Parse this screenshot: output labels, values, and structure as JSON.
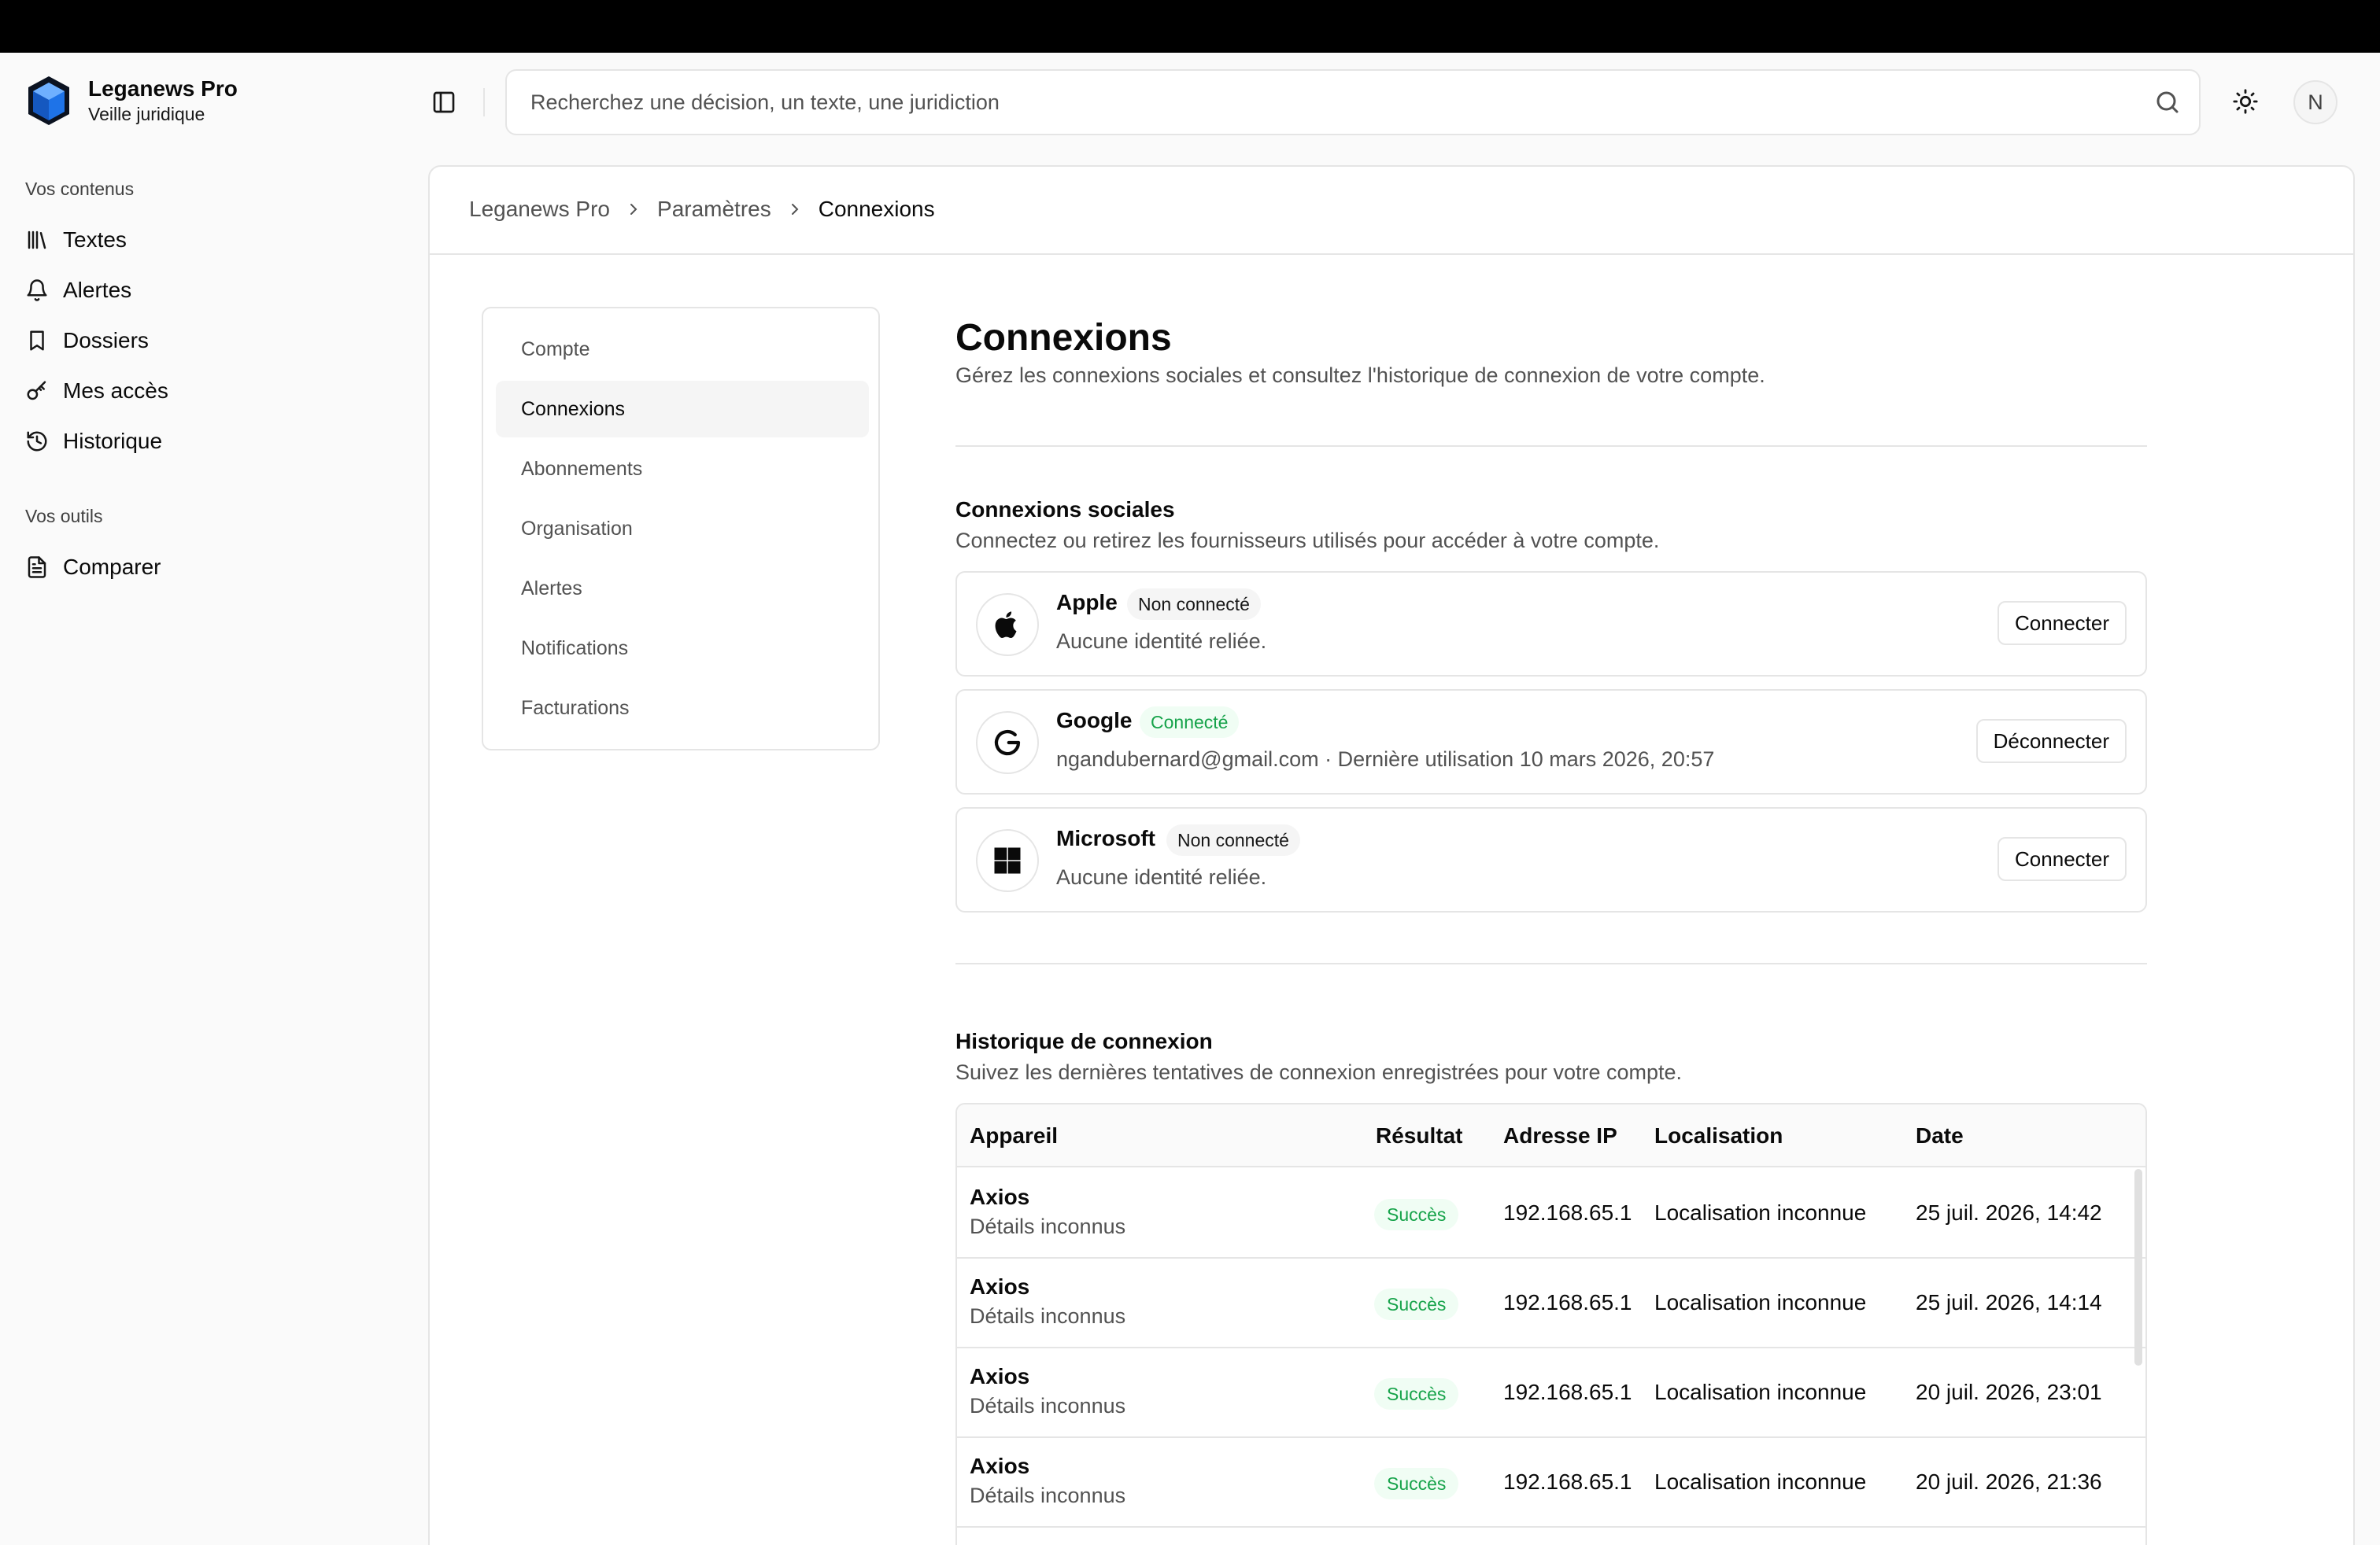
{
  "brand": {
    "name": "Leganews Pro",
    "subtitle": "Veille juridique"
  },
  "sidebar": {
    "group1_label": "Vos contenus",
    "items": [
      {
        "label": "Textes",
        "icon": "library-icon"
      },
      {
        "label": "Alertes",
        "icon": "bell-icon"
      },
      {
        "label": "Dossiers",
        "icon": "bookmark-icon"
      },
      {
        "label": "Mes accès",
        "icon": "key-icon"
      },
      {
        "label": "Historique",
        "icon": "history-icon"
      }
    ],
    "group2_label": "Vos outils",
    "tools": [
      {
        "label": "Comparer",
        "icon": "document-icon"
      }
    ]
  },
  "search": {
    "placeholder": "Recherchez une décision, un texte, une juridiction"
  },
  "user": {
    "initial": "N"
  },
  "breadcrumb": [
    "Leganews Pro",
    "Paramètres",
    "Connexions"
  ],
  "settings_nav": [
    "Compte",
    "Connexions",
    "Abonnements",
    "Organisation",
    "Alertes",
    "Notifications",
    "Facturations"
  ],
  "page": {
    "title": "Connexions",
    "subtitle": "Gérez les connexions sociales et consultez l'historique de connexion de votre compte."
  },
  "social": {
    "title": "Connexions sociales",
    "subtitle": "Connectez ou retirez les fournisseurs utilisés pour accéder à votre compte.",
    "providers": [
      {
        "name": "Apple",
        "status": "Non connecté",
        "desc": "Aucune identité reliée.",
        "action": "Connecter"
      },
      {
        "name": "Google",
        "status": "Connecté",
        "desc": "ngandubernard@gmail.com · Dernière utilisation 10 mars 2026, 20:57",
        "action": "Déconnecter"
      },
      {
        "name": "Microsoft",
        "status": "Non connecté",
        "desc": "Aucune identité reliée.",
        "action": "Connecter"
      }
    ]
  },
  "history": {
    "title": "Historique de connexion",
    "subtitle": "Suivez les dernières tentatives de connexion enregistrées pour votre compte.",
    "columns": [
      "Appareil",
      "Résultat",
      "Adresse IP",
      "Localisation",
      "Date"
    ],
    "rows": [
      {
        "device": "Axios",
        "details": "Détails inconnus",
        "result": "Succès",
        "ip": "192.168.65.1",
        "location": "Localisation inconnue",
        "date": "25 juil. 2026, 14:42"
      },
      {
        "device": "Axios",
        "details": "Détails inconnus",
        "result": "Succès",
        "ip": "192.168.65.1",
        "location": "Localisation inconnue",
        "date": "25 juil. 2026, 14:14"
      },
      {
        "device": "Axios",
        "details": "Détails inconnus",
        "result": "Succès",
        "ip": "192.168.65.1",
        "location": "Localisation inconnue",
        "date": "20 juil. 2026, 23:01"
      },
      {
        "device": "Axios",
        "details": "Détails inconnus",
        "result": "Succès",
        "ip": "192.168.65.1",
        "location": "Localisation inconnue",
        "date": "20 juil. 2026, 21:36"
      }
    ]
  },
  "colors": {
    "accent": "#1e73e8",
    "success": "#16a34a",
    "border": "#e5e5e5"
  }
}
